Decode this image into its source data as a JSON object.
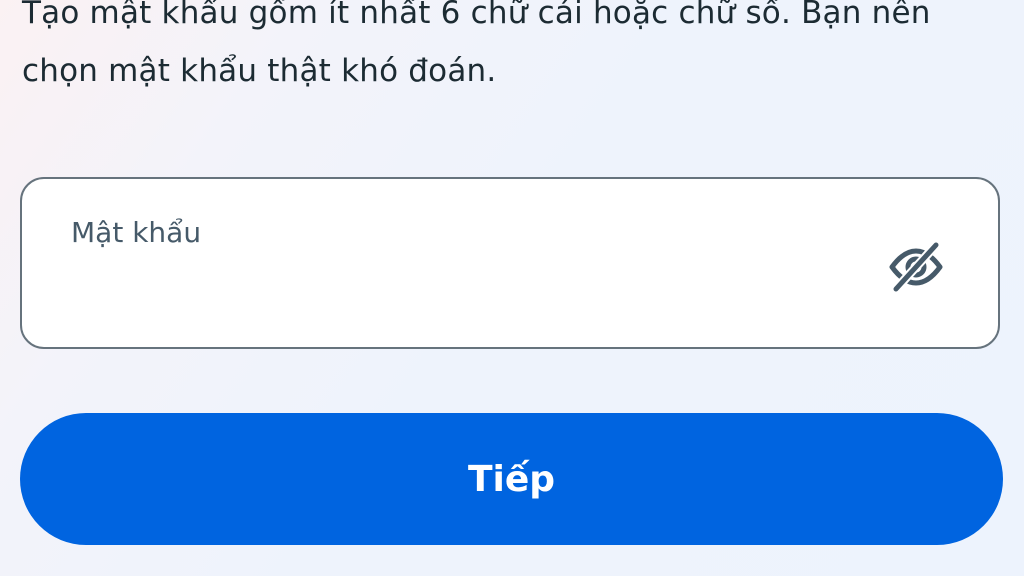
{
  "instruction": {
    "text": "Tạo mật khẩu gồm ít nhất 6 chữ cái hoặc chữ số. Bạn nên chọn mật khẩu thật khó đoán."
  },
  "password_field": {
    "label": "Mật khẩu",
    "value": "",
    "visibility_icon": "eye-slash-icon"
  },
  "next_button": {
    "label": "Tiếp"
  },
  "colors": {
    "primary": "#0064e0",
    "text": "#1c2b33",
    "label": "#465a69",
    "field_border": "#66737d"
  }
}
